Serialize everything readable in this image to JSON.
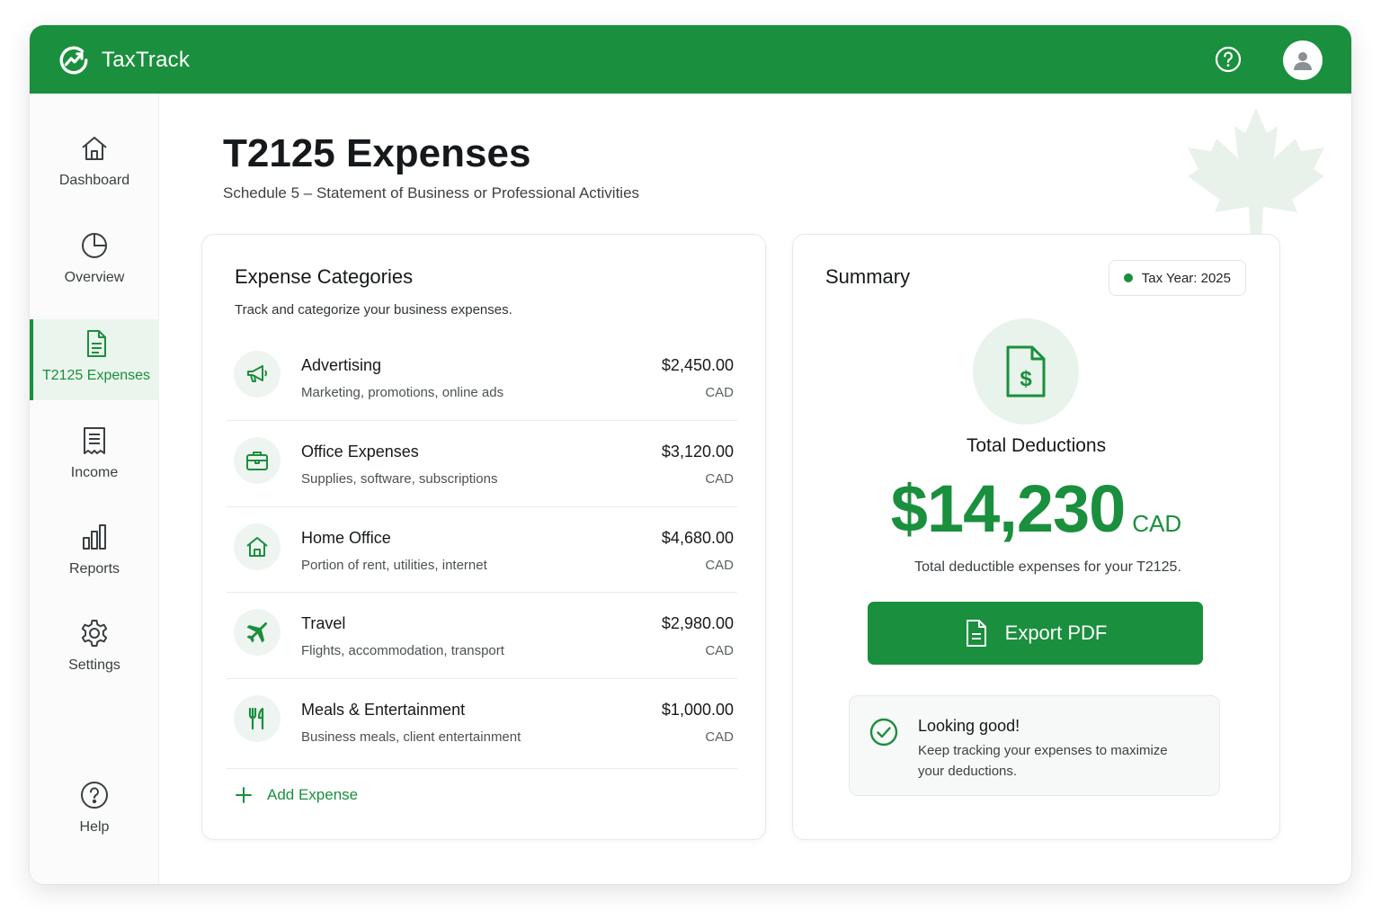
{
  "app": {
    "name": "TaxTrack"
  },
  "header": {
    "help_icon": "help-circle-icon",
    "avatar_icon": "user-icon"
  },
  "sidebar": {
    "items": [
      {
        "label": "Dashboard",
        "icon": "home-icon"
      },
      {
        "label": "Overview",
        "icon": "pie-chart-icon"
      },
      {
        "label": "T2125 Expenses",
        "icon": "document-icon",
        "active": true
      },
      {
        "label": "Income",
        "icon": "receipt-icon"
      },
      {
        "label": "Reports",
        "icon": "bar-chart-icon"
      },
      {
        "label": "Settings",
        "icon": "gear-icon"
      }
    ],
    "help": {
      "label": "Help",
      "icon": "help-circle-icon"
    }
  },
  "page": {
    "title": "T2125 Expenses",
    "subtitle": "Schedule 5 – Statement of Business or Professional Activities"
  },
  "expenses": {
    "title": "Expense Categories",
    "description": "Track and categorize your business expenses.",
    "rows": [
      {
        "name": "Advertising",
        "desc": "Marketing, promotions, online ads",
        "amount": "$2,450.00",
        "currency": "CAD",
        "icon": "megaphone-icon"
      },
      {
        "name": "Office Expenses",
        "desc": "Supplies, software, subscriptions",
        "amount": "$3,120.00",
        "currency": "CAD",
        "icon": "briefcase-icon"
      },
      {
        "name": "Home Office",
        "desc": "Portion of rent, utilities, internet",
        "amount": "$4,680.00",
        "currency": "CAD",
        "icon": "home-icon"
      },
      {
        "name": "Travel",
        "desc": "Flights, accommodation, transport",
        "amount": "$2,980.00",
        "currency": "CAD",
        "icon": "plane-icon"
      },
      {
        "name": "Meals & Entertainment",
        "desc": "Business meals, client entertainment",
        "amount": "$1,000.00",
        "currency": "CAD",
        "icon": "utensils-icon"
      }
    ],
    "add_label": "Add Expense"
  },
  "summary": {
    "title": "Summary",
    "tax_year": "Tax Year: 2025",
    "total_label": "Total Deductions",
    "total_value": "$14,230",
    "total_currency": "CAD",
    "total_desc": "Total deductible expenses for your T2125.",
    "export_label": "Export PDF",
    "note_title": "Looking good!",
    "note_desc": "Keep tracking your expenses to maximize your deductions."
  },
  "colors": {
    "brand": "#1a8f3d",
    "accent_light": "#eaf5ed"
  }
}
